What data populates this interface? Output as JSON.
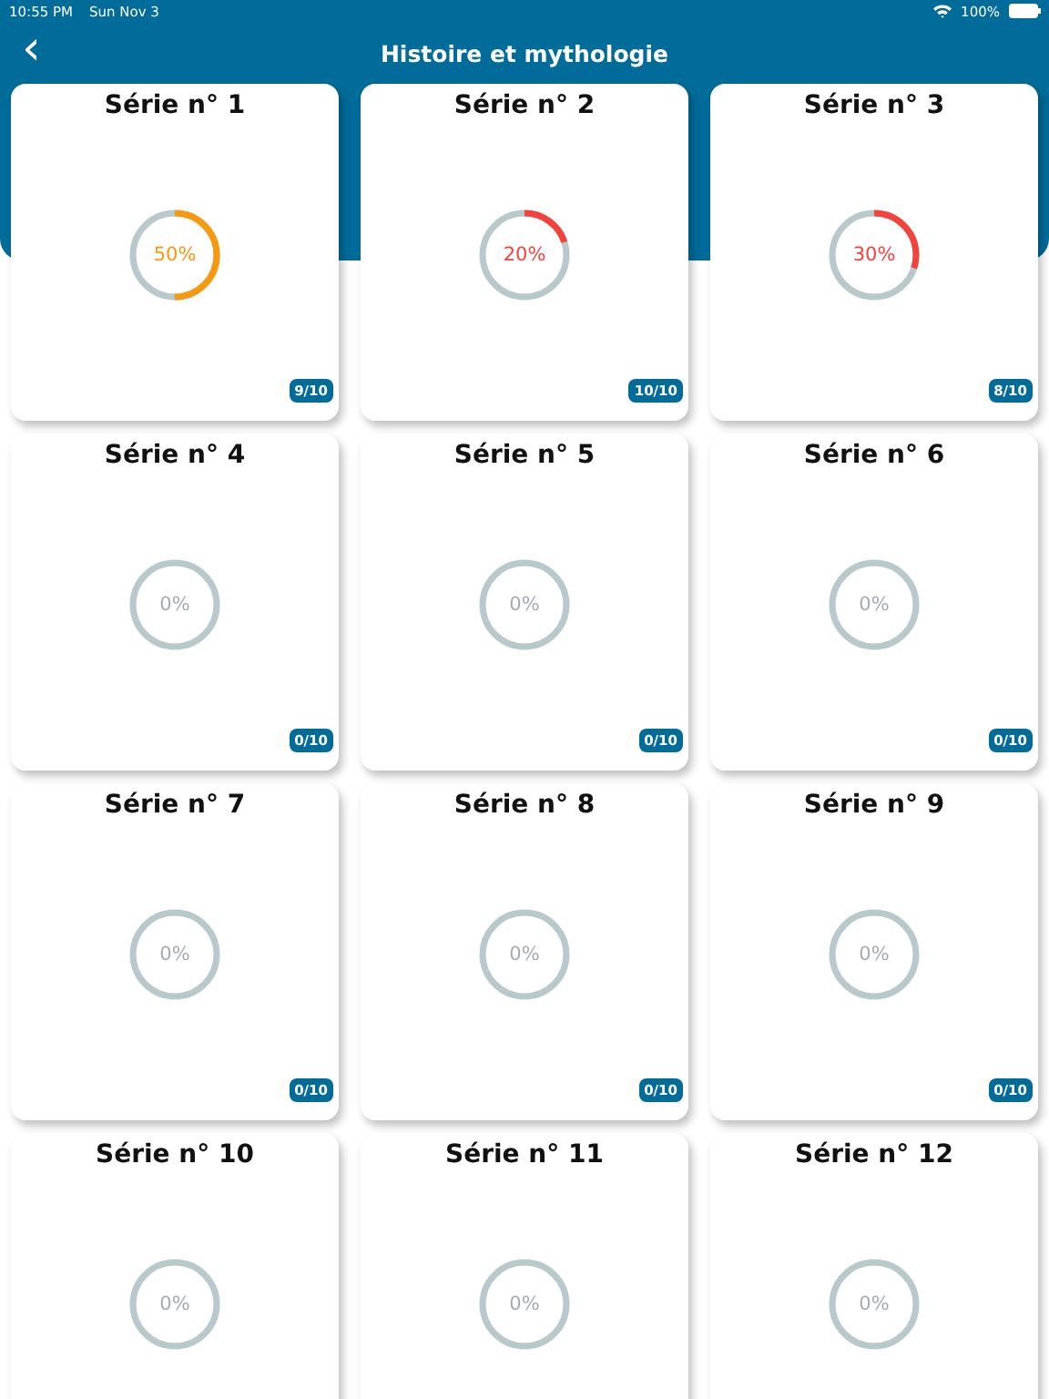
{
  "status_bar": {
    "time": "10:55 PM",
    "date": "Sun Nov 3",
    "battery": "100%"
  },
  "nav": {
    "back_icon": "‹",
    "title": "Histoire et mythologie"
  },
  "series": [
    {
      "title": "Série n° 1",
      "percent": "50%",
      "level": 0.5,
      "color": "#f7980f",
      "score": "9/10"
    },
    {
      "title": "Série n° 2",
      "percent": "20%",
      "level": 0.2,
      "color": "#f4433b",
      "score": "10/10"
    },
    {
      "title": "Série n° 3",
      "percent": "30%",
      "level": 0.3,
      "color": "#f4433b",
      "score": "8/10"
    },
    {
      "title": "Série n° 4",
      "percent": "0%",
      "level": 0,
      "color": "#a3aeb2",
      "score": "0/10"
    },
    {
      "title": "Série n° 5",
      "percent": "0%",
      "level": 0,
      "color": "#a3aeb2",
      "score": "0/10"
    },
    {
      "title": "Série n° 6",
      "percent": "0%",
      "level": 0,
      "color": "#a3aeb2",
      "score": "0/10"
    },
    {
      "title": "Série n° 7",
      "percent": "0%",
      "level": 0,
      "color": "#a3aeb2",
      "score": "0/10"
    },
    {
      "title": "Série n° 8",
      "percent": "0%",
      "level": 0,
      "color": "#a3aeb2",
      "score": "0/10"
    },
    {
      "title": "Série n° 9",
      "percent": "0%",
      "level": 0,
      "color": "#a3aeb2",
      "score": "0/10"
    },
    {
      "title": "Série n° 10",
      "percent": "0%",
      "level": 0,
      "color": "#a3aeb2"
    },
    {
      "title": "Série n° 11",
      "percent": "0%",
      "level": 0,
      "color": "#a3aeb2"
    },
    {
      "title": "Série n° 12",
      "percent": "0%",
      "level": 0,
      "color": "#a3aeb2"
    }
  ]
}
